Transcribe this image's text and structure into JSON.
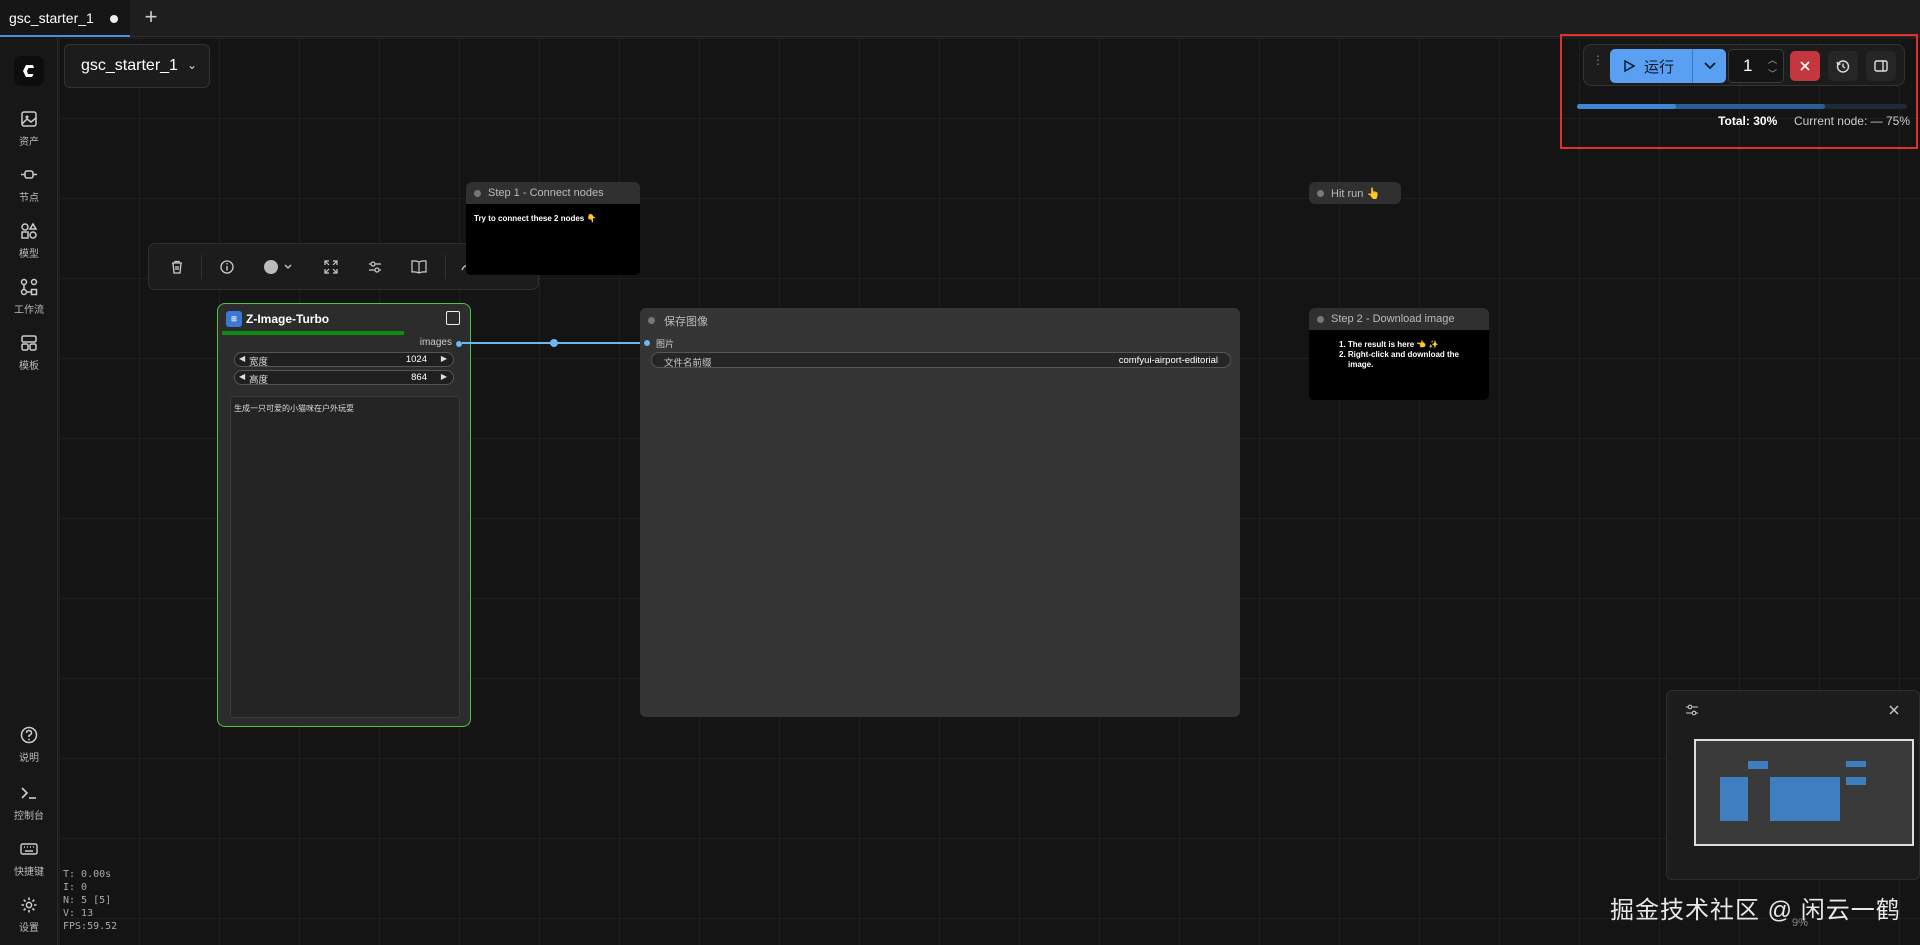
{
  "tab": {
    "label": "gsc_starter_1"
  },
  "sidebar": {
    "items": [
      {
        "label": "资产",
        "icon": "image-icon"
      },
      {
        "label": "节点",
        "icon": "node-icon"
      },
      {
        "label": "模型",
        "icon": "shapes-icon"
      },
      {
        "label": "工作流",
        "icon": "workflow-icon"
      },
      {
        "label": "模板",
        "icon": "template-icon"
      }
    ],
    "bottom": [
      {
        "label": "说明",
        "icon": "help-icon"
      },
      {
        "label": "控制台",
        "icon": "terminal-icon"
      },
      {
        "label": "快捷键",
        "icon": "keyboard-icon"
      },
      {
        "label": "设置",
        "icon": "gear-icon"
      }
    ]
  },
  "workflow_select": {
    "label": "gsc_starter_1"
  },
  "run_panel": {
    "run_label": "运行",
    "count": "1",
    "progress_total_pct": 30,
    "progress_node_pct": 75,
    "total_label": "Total:",
    "total_value": "30%",
    "current_node_label": "Current node: — 75%"
  },
  "notes": {
    "step1": {
      "title": "Step 1 - Connect nodes",
      "body": "Try to connect these 2 nodes 👇"
    },
    "hitrun": {
      "title": "Hit run 👆"
    },
    "step2": {
      "title": "Step 2 - Download image",
      "line1": "1. The result is here 👈 ✨",
      "line2": "2. Right-click and download the",
      "line3": "image."
    }
  },
  "zimage_node": {
    "title": "Z-Image-Turbo",
    "output_label": "images",
    "width_label": "宽度",
    "width_value": "1024",
    "height_label": "高度",
    "height_value": "864",
    "prompt": "生成一只可爱的小猫咪在户外玩耍",
    "progress_pct": 80
  },
  "save_node": {
    "title": "保存图像",
    "input_label": "图片",
    "prefix_label": "文件名前缀",
    "prefix_value": "comfyui-airport-editorial"
  },
  "stats": {
    "t": "T: 0.00s",
    "i": "I: 0",
    "n": "N: 5 [5]",
    "v": "V: 13",
    "fps": "FPS:59.52"
  },
  "watermark": "掘金技术社区 @ 闲云一鹤",
  "minimap_zoom": "9%",
  "colors": {
    "accent": "#5aa0f2",
    "stop": "#c4373e",
    "node_selected": "#43c943"
  }
}
